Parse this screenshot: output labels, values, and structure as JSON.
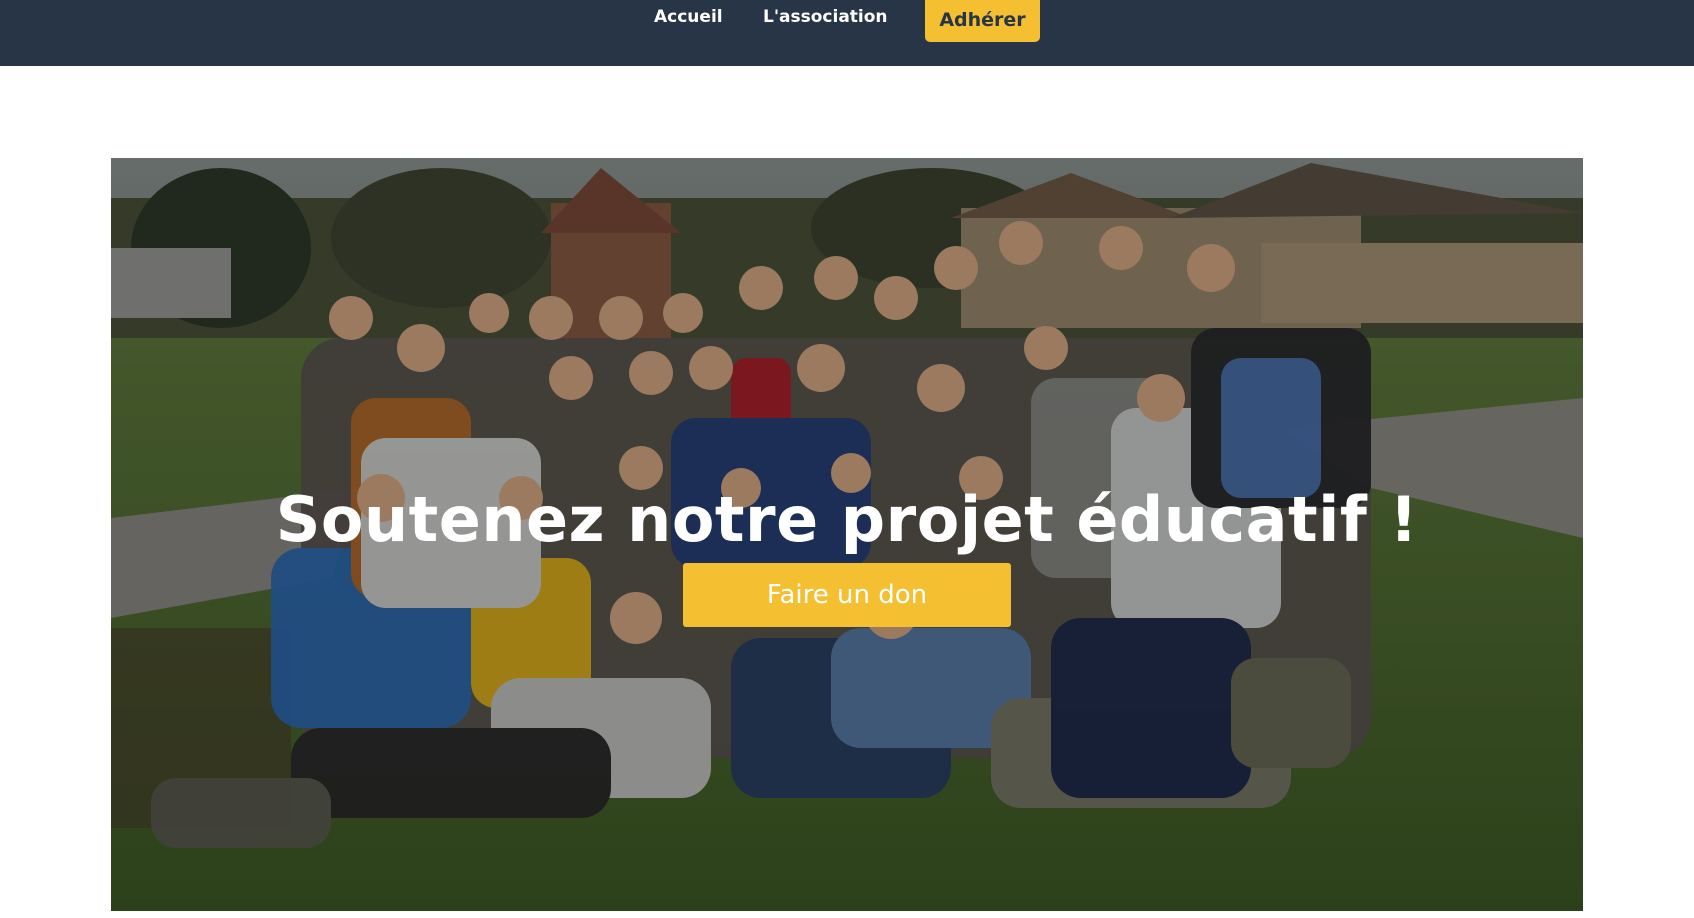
{
  "nav": {
    "items": [
      {
        "label": "Accueil"
      },
      {
        "label": "L'association"
      }
    ],
    "cta_label": "Adhérer"
  },
  "hero": {
    "title": "Soutenez notre projet éducatif !",
    "button_label": "Faire un don"
  },
  "colors": {
    "topbar": "#283546",
    "accent": "#f5bf32",
    "text_light": "#ffffff"
  }
}
